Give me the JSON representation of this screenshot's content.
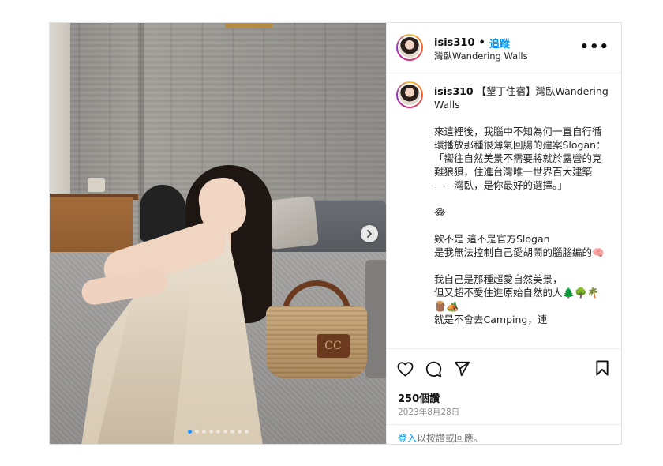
{
  "header": {
    "username": "isis310",
    "separator": "•",
    "follow_label": "追蹤",
    "location": "灣臥Wandering Walls",
    "more_label": "•••"
  },
  "photo": {
    "bag_logo": "CC",
    "carousel_dot_count": 9,
    "active_dot_index": 0
  },
  "caption": {
    "username": "isis310",
    "text": " 【墾丁住宿】灣臥Wandering Walls\n\n來這裡後，我腦中不知為何一直自行循環播放那種很薄氣回腸的建案Slogan：\n「嚮往自然美景不需要將就於露營的克難狼狽，住進台灣唯一世界百大建築——灣臥，是你最好的選擇。」\n\n😂\n\n欸不是 這不是官方Slogan\n是我無法控制自己愛胡鬧的腦腦編的🧠\n\n我自己是那種超愛自然美景，\n但又超不愛住進原始自然的人🌲🌳🌴🪵🏕️\n就是不會去Camping，連"
  },
  "actions": {
    "like_icon": "heart-icon",
    "comment_icon": "comment-icon",
    "share_icon": "paper-plane-icon",
    "save_icon": "bookmark-icon",
    "likes": "250個讚",
    "date": "2023年8月28日"
  },
  "login": {
    "link_label": "登入",
    "rest": "以按讚或回應。"
  }
}
